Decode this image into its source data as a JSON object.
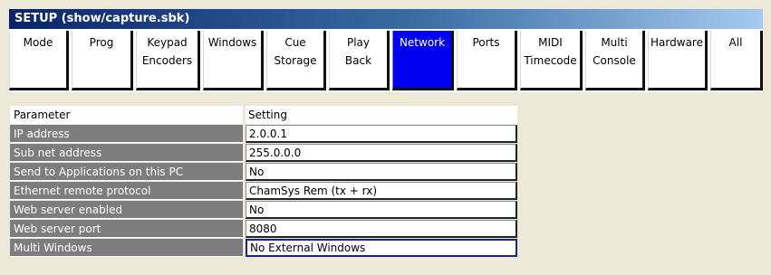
{
  "window": {
    "title": "SETUP (show/capture.sbk)"
  },
  "tabs": [
    {
      "line1": "Mode",
      "line2": ""
    },
    {
      "line1": "Prog",
      "line2": ""
    },
    {
      "line1": "Keypad",
      "line2": "Encoders"
    },
    {
      "line1": "Windows",
      "line2": ""
    },
    {
      "line1": "Cue",
      "line2": "Storage"
    },
    {
      "line1": "Play",
      "line2": "Back"
    },
    {
      "line1": "Network",
      "line2": ""
    },
    {
      "line1": "Ports",
      "line2": ""
    },
    {
      "line1": "MIDI",
      "line2": "Timecode"
    },
    {
      "line1": "Multi",
      "line2": "Console"
    },
    {
      "line1": "Hardware",
      "line2": ""
    },
    {
      "line1": "All",
      "line2": ""
    }
  ],
  "active_tab": "Network",
  "colors": {
    "active_tab": "#0000f0",
    "param_cell": "#7d7d7d",
    "title_bar": "#0a246a"
  },
  "table": {
    "headers": {
      "parameter": "Parameter",
      "setting": "Setting"
    },
    "rows": [
      {
        "parameter": "IP address",
        "setting": "2.0.0.1"
      },
      {
        "parameter": "Sub net address",
        "setting": "255.0.0.0"
      },
      {
        "parameter": "Send to Applications on this PC",
        "setting": "No"
      },
      {
        "parameter": "Ethernet remote protocol",
        "setting": "ChamSys Rem (tx + rx)"
      },
      {
        "parameter": "Web server enabled",
        "setting": "No"
      },
      {
        "parameter": "Web server port",
        "setting": "8080"
      },
      {
        "parameter": "Multi Windows",
        "setting": "No External Windows"
      }
    ],
    "selected_row": "Multi Windows"
  }
}
